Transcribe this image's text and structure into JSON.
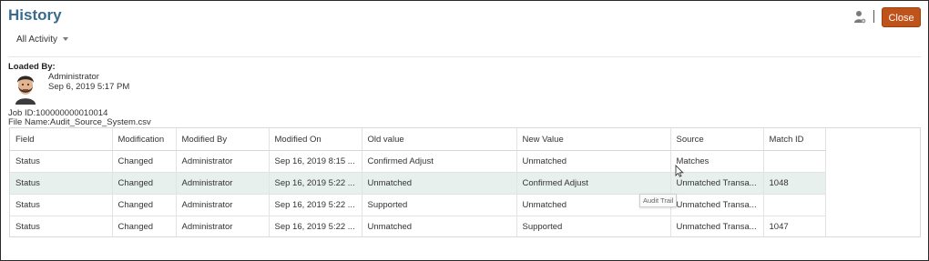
{
  "header": {
    "title": "History",
    "close_label": "Close"
  },
  "filter": {
    "selected": "All Activity"
  },
  "loaded_by": {
    "label": "Loaded By:",
    "user": "Administrator",
    "date": "Sep 6, 2019 5:17 PM"
  },
  "job": {
    "id_text": "Job ID:100000000010014",
    "file_text": "File Name:Audit_Source_System.csv"
  },
  "table": {
    "columns": [
      "Field",
      "Modification",
      "Modified By",
      "Modified On",
      "Old value",
      "New Value",
      "Source",
      "Match ID"
    ],
    "rows": [
      [
        "Status",
        "Changed",
        "Administrator",
        "Sep 16, 2019 8:15 ...",
        "Confirmed Adjust",
        "Unmatched",
        "Matches",
        ""
      ],
      [
        "Status",
        "Changed",
        "Administrator",
        "Sep 16, 2019 5:22 ...",
        "Unmatched",
        "Confirmed Adjust",
        "Unmatched Transa...",
        "1048"
      ],
      [
        "Status",
        "Changed",
        "Administrator",
        "Sep 16, 2019 5:22 ...",
        "Supported",
        "Unmatched",
        "Unmatched Transa...",
        ""
      ],
      [
        "Status",
        "Changed",
        "Administrator",
        "Sep 16, 2019 5:22 ...",
        "Unmatched",
        "Supported",
        "Unmatched Transa...",
        "1047"
      ]
    ]
  },
  "tooltip": {
    "text": "Audit Trail"
  },
  "colors": {
    "title": "#3a6a8c",
    "close_button": "#c0531a",
    "highlight_row": "#e8f0ee"
  },
  "icons": [
    "user-settings-icon",
    "chevron-down-icon",
    "avatar",
    "mouse-cursor-icon"
  ]
}
